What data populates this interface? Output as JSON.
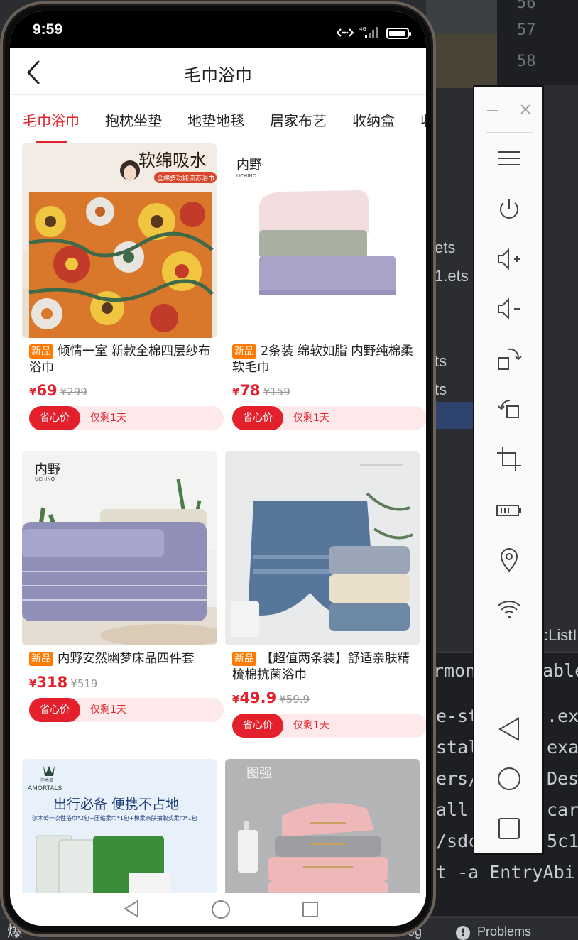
{
  "ide": {
    "line_numbers": [
      "56",
      "57",
      "58"
    ],
    "tree_items": [
      "ets",
      "1.ets",
      "ts",
      "ts"
    ],
    "panel_header": ":ListI",
    "terminal_left": [
      "rmon",
      "e-st",
      "stal",
      "ers/",
      "all",
      "/sdc",
      "t -a EntryAbi"
    ],
    "terminal_right": [
      "ableH",
      ".ex",
      "exa",
      "Des",
      "car",
      "5c1"
    ],
    "bottom_left": "爆",
    "bottom_log": "og",
    "bottom_problems": "Problems"
  },
  "status_bar": {
    "time": "9:59",
    "network": "4G"
  },
  "nav": {
    "title": "毛巾浴巾"
  },
  "tabs": [
    {
      "label": "毛巾浴巾",
      "active": true
    },
    {
      "label": "抱枕坐垫",
      "active": false
    },
    {
      "label": "地垫地毯",
      "active": false
    },
    {
      "label": "居家布艺",
      "active": false
    },
    {
      "label": "收纳盒",
      "active": false
    },
    {
      "label": "收",
      "active": false
    }
  ],
  "products": [
    {
      "badge": "新品",
      "name": "倾情一室 新款全棉四层纱布浴巾",
      "currency": "¥",
      "price": "69",
      "original_price": "¥299",
      "deal_label": "省心价",
      "deal_text": "仅剩1天",
      "image_text": "软绵吸水",
      "image_subtext": "全棉多功能流苏浴巾"
    },
    {
      "badge": "新品",
      "name": "2条装 绵软如脂 内野纯棉柔软毛巾",
      "currency": "¥",
      "price": "78",
      "original_price": "¥159",
      "deal_label": "省心价",
      "deal_text": "仅剩1天",
      "image_text": "内野",
      "image_subtext": "UCHINO"
    },
    {
      "badge": "新品",
      "name": "内野安然幽梦床品四件套",
      "currency": "¥",
      "price": "318",
      "original_price": "¥519",
      "deal_label": "省心价",
      "deal_text": "仅剩1天",
      "image_text": "内野",
      "image_subtext": "UCHINO"
    },
    {
      "badge": "新品",
      "name": "【超值两条装】舒适亲肤精梳棉抗菌浴巾",
      "currency": "¥",
      "price": "49.9",
      "original_price": "¥59.9",
      "deal_label": "省心价",
      "deal_text": "仅剩1天"
    },
    {
      "image_text": "出行必备 便携不占地",
      "image_subtext": "尔木萄一次性浴巾*2包+压缩柔巾*1包+棉柔亲肤抽取式柔巾*1包",
      "image_brand": "AMORTALS",
      "image_brand_cn": "尔木萄"
    },
    {
      "image_text": "图强"
    }
  ],
  "emulator_tools": [
    "minimize",
    "close",
    "menu",
    "power",
    "volume-up",
    "volume-down",
    "rotate-right",
    "rotate-left",
    "screenshot-crop",
    "battery",
    "location",
    "wifi",
    "back",
    "home",
    "recents"
  ],
  "colors": {
    "accent": "#e3202b",
    "badge": "#ff7a00",
    "deal_bg": "#fde8ea"
  }
}
